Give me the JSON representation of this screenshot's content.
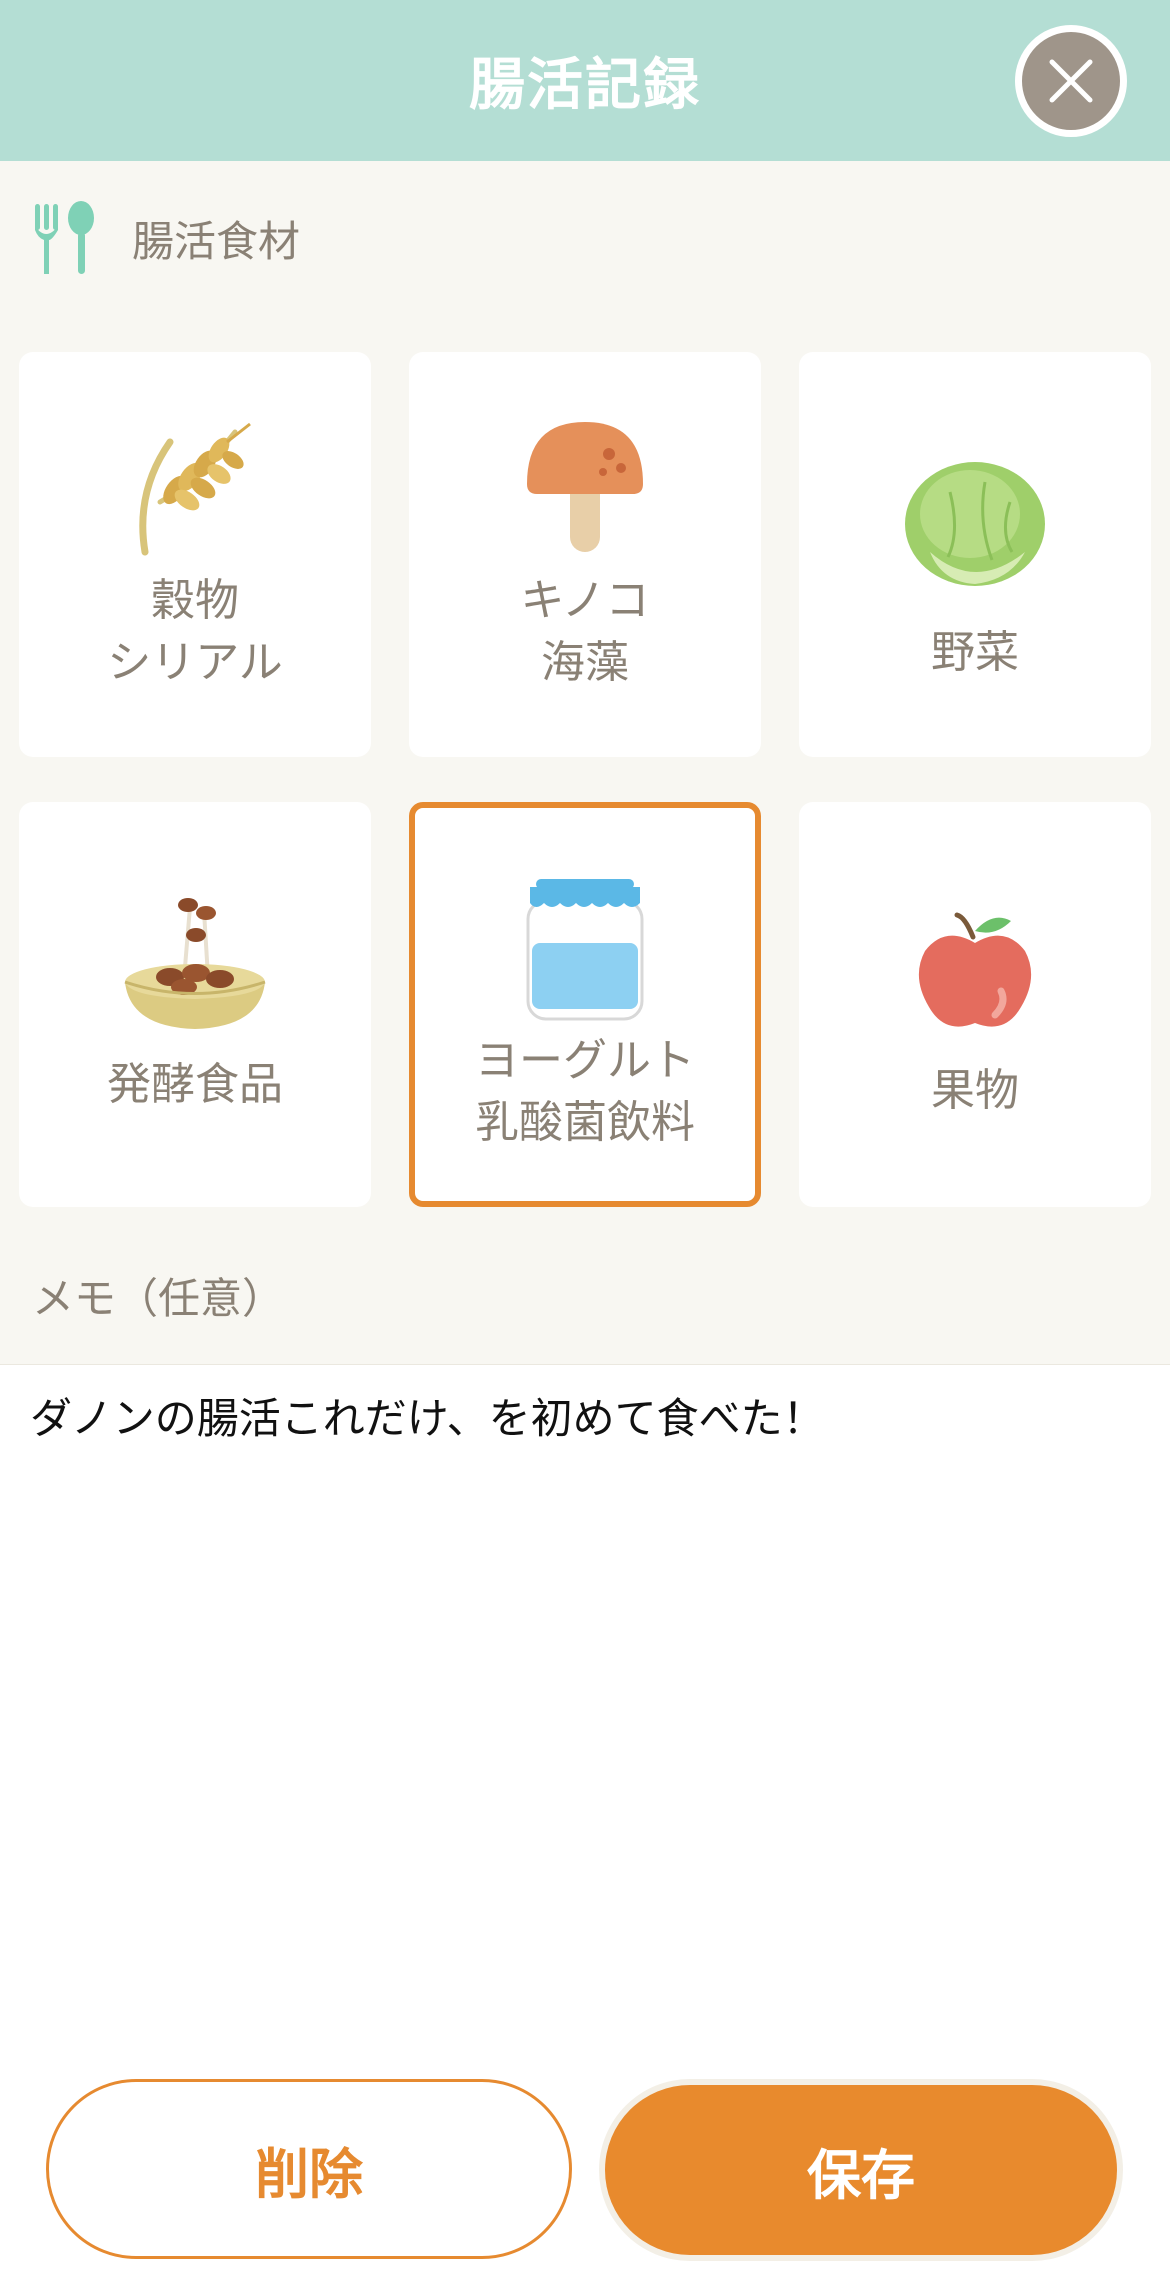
{
  "header": {
    "title": "腸活記録"
  },
  "section": {
    "title": "腸活食材"
  },
  "categories": [
    {
      "label1": "穀物",
      "label2": "シリアル",
      "icon": "wheat-icon"
    },
    {
      "label1": "キノコ",
      "label2": "海藻",
      "icon": "mushroom-icon"
    },
    {
      "label1": "野菜",
      "label2": "",
      "icon": "cabbage-icon"
    },
    {
      "label1": "発酵食品",
      "label2": "",
      "icon": "natto-bowl-icon"
    },
    {
      "label1": "ヨーグルト",
      "label2": "乳酸菌飲料",
      "icon": "yogurt-jar-icon",
      "selected": true
    },
    {
      "label1": "果物",
      "label2": "",
      "icon": "apple-icon"
    }
  ],
  "memo": {
    "label": "メモ（任意）",
    "value": "ダノンの腸活これだけ、を初めて食べた！"
  },
  "buttons": {
    "delete": "削除",
    "save": "保存"
  },
  "colors": {
    "header": "#b4ded4",
    "accent": "#e68a30",
    "background": "#f8f7f2"
  }
}
